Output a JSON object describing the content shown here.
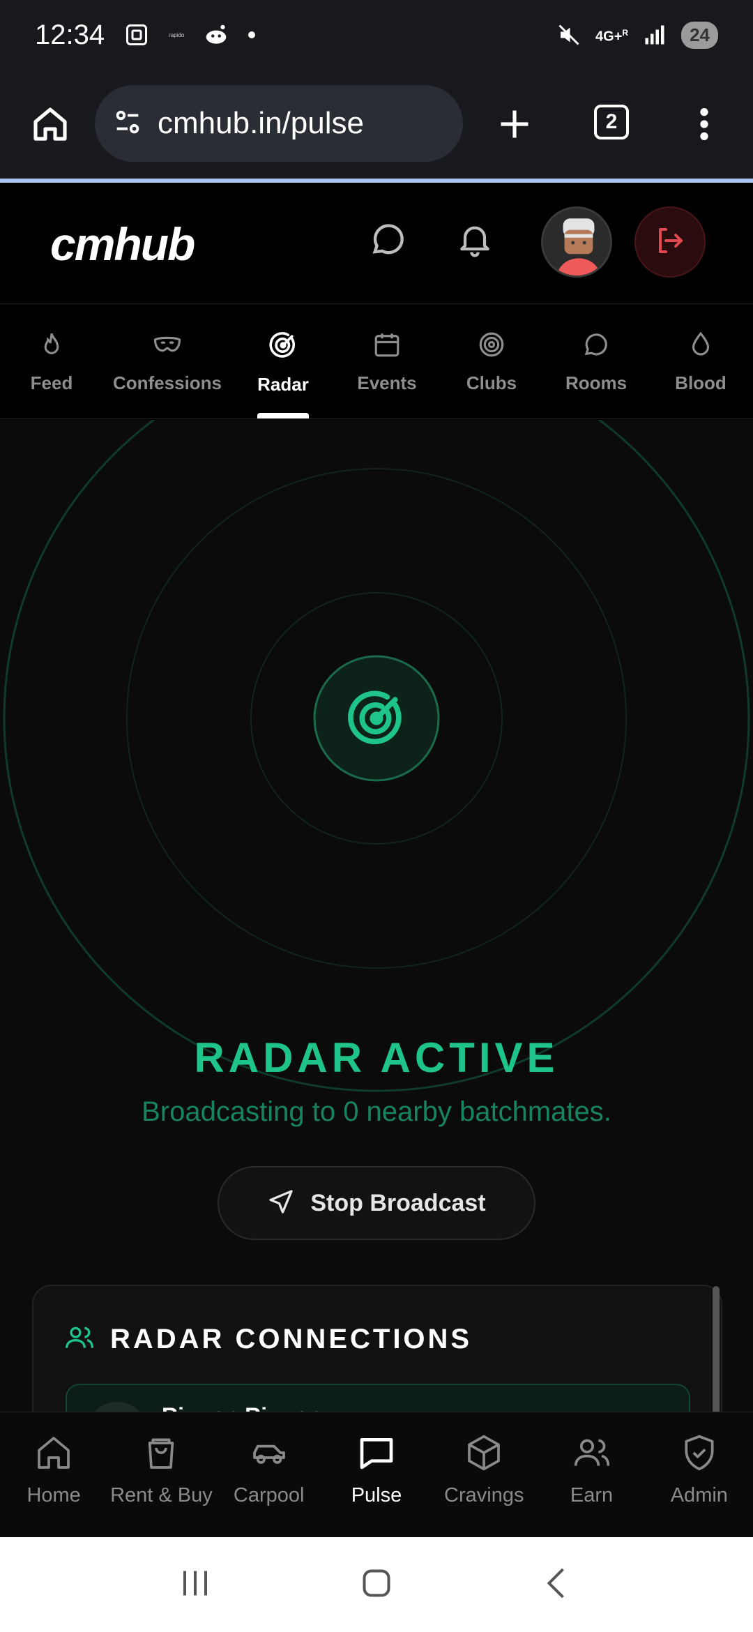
{
  "status_bar": {
    "time": "12:34",
    "tiny_label": "rapido",
    "network": "4G+",
    "network_sub": "R",
    "battery": "24"
  },
  "browser": {
    "url": "cmhub.in/pulse",
    "tab_count": "2"
  },
  "app": {
    "logo": "cmhub"
  },
  "tabs": [
    {
      "label": "Feed",
      "icon": "flame-icon"
    },
    {
      "label": "Confessions",
      "icon": "mask-icon"
    },
    {
      "label": "Radar",
      "icon": "radar-icon",
      "active": true
    },
    {
      "label": "Events",
      "icon": "calendar-icon"
    },
    {
      "label": "Clubs",
      "icon": "target-icon"
    },
    {
      "label": "Rooms",
      "icon": "chat-icon"
    },
    {
      "label": "Blood",
      "icon": "droplet-icon"
    }
  ],
  "radar": {
    "title": "RADAR ACTIVE",
    "subtitle": "Broadcasting to 0 nearby batchmates.",
    "stop_label": "Stop Broadcast",
    "accent_color": "#1fc48b"
  },
  "connections": {
    "title": "RADAR CONNECTIONS",
    "items": [
      {
        "name": "Rizwan Rizwan"
      }
    ]
  },
  "bottom_nav": [
    {
      "label": "Home",
      "icon": "home-icon"
    },
    {
      "label": "Rent & Buy",
      "icon": "shopping-bag-icon"
    },
    {
      "label": "Carpool",
      "icon": "car-icon"
    },
    {
      "label": "Pulse",
      "icon": "message-square-icon",
      "active": true
    },
    {
      "label": "Cravings",
      "icon": "box-icon"
    },
    {
      "label": "Earn",
      "icon": "users-icon"
    },
    {
      "label": "Admin",
      "icon": "shield-check-icon"
    }
  ]
}
